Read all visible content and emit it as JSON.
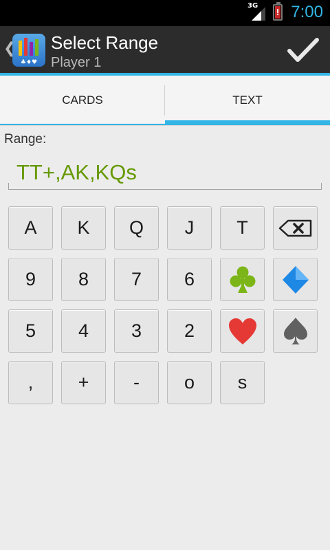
{
  "status_bar": {
    "time": "7:00",
    "network_label": "3G",
    "icons": [
      "signal-icon",
      "battery-alert-icon"
    ]
  },
  "action_bar": {
    "title": "Select Range",
    "subtitle": "Player 1",
    "icons": [
      "back-chevron-icon",
      "app-logo-icon",
      "checkmark-icon"
    ]
  },
  "tabs": [
    {
      "label": "CARDS",
      "selected": false
    },
    {
      "label": "TEXT",
      "selected": true
    }
  ],
  "range": {
    "label": "Range:",
    "value": "TT+,AK,KQs"
  },
  "keypad": {
    "row1": [
      "A",
      "K",
      "Q",
      "J",
      "T"
    ],
    "row2": [
      "9",
      "8",
      "7",
      "6"
    ],
    "row3": [
      "5",
      "4",
      "3",
      "2"
    ],
    "row4": [
      ",",
      "+",
      "-",
      "o",
      "s"
    ],
    "icons": [
      "backspace-icon",
      "club-suit-icon",
      "diamond-suit-icon",
      "heart-suit-icon",
      "spade-suit-icon"
    ]
  },
  "colors": {
    "accent": "#33b5e5",
    "range_text": "#669900",
    "club": "#7cb518",
    "diamond": "#1e88e5",
    "heart": "#e53935",
    "spade": "#616161"
  }
}
